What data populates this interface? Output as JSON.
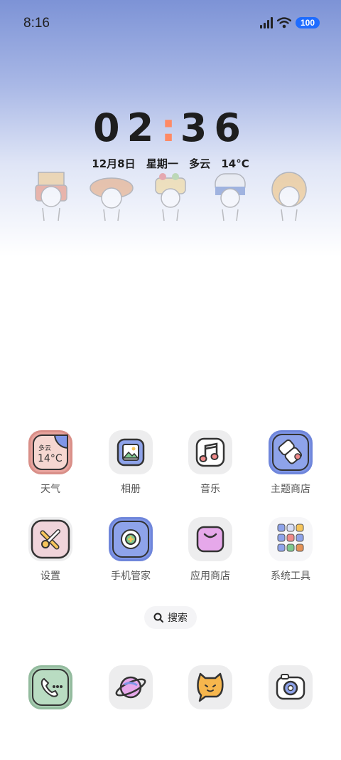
{
  "status": {
    "time": "8:16",
    "battery": "100"
  },
  "lockscreen": {
    "clock_hours": "02",
    "clock_minutes": "36",
    "date": "12月8日",
    "weekday": "星期一",
    "weather": "多云",
    "temperature": "14°C"
  },
  "apps": [
    {
      "label": "天气",
      "icon": "weather-icon",
      "widget_text_top": "多云",
      "widget_text_main": "14°C"
    },
    {
      "label": "相册",
      "icon": "gallery-icon"
    },
    {
      "label": "音乐",
      "icon": "music-icon"
    },
    {
      "label": "主题商店",
      "icon": "theme-store-icon"
    },
    {
      "label": "设置",
      "icon": "settings-icon"
    },
    {
      "label": "手机管家",
      "icon": "phone-manager-icon"
    },
    {
      "label": "应用商店",
      "icon": "app-store-icon"
    },
    {
      "label": "系统工具",
      "icon": "system-tools-folder-icon"
    }
  ],
  "search": {
    "label": "搜索"
  },
  "dock": [
    {
      "icon": "phone-icon"
    },
    {
      "icon": "browser-planet-icon"
    },
    {
      "icon": "messages-cat-icon"
    },
    {
      "icon": "camera-icon"
    }
  ],
  "colors": {
    "weather_bg": "#e8a49e",
    "blue_accent": "#7f96e8",
    "pink_bg": "#f0d4da",
    "clock_colon": "#ff8a65",
    "battery": "#1e6cff"
  }
}
